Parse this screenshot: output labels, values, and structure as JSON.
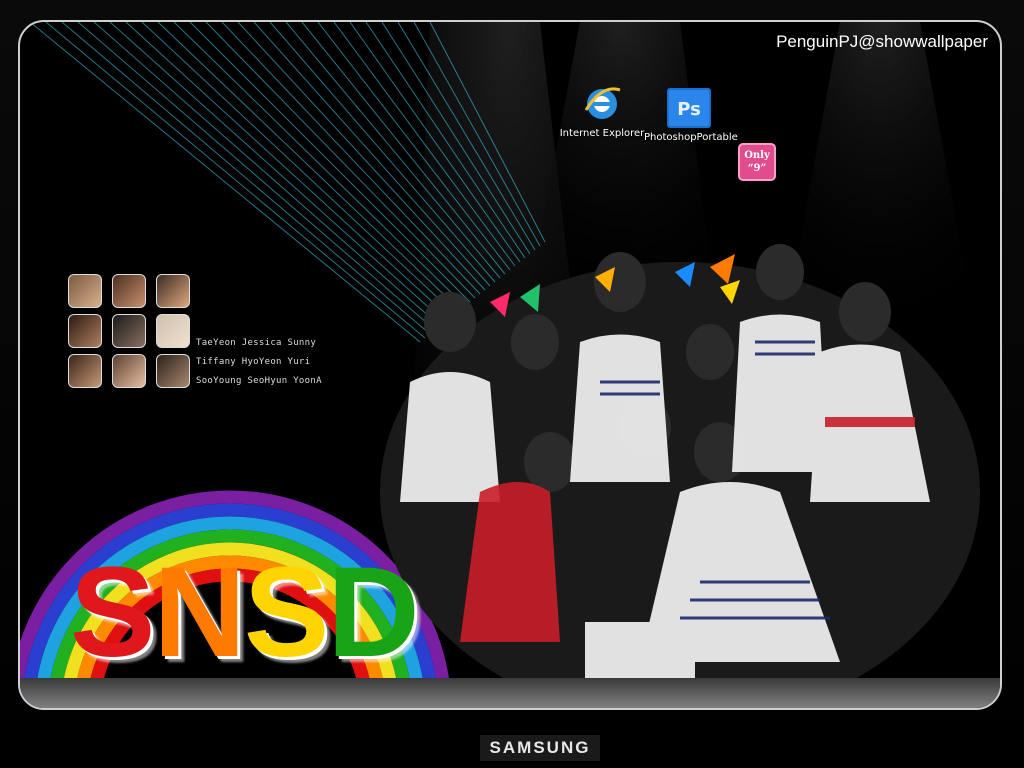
{
  "wallpaper": {
    "credit": "PenguinPJ@showwallpaper",
    "badge": {
      "line1": "Only",
      "line2": "“9”"
    },
    "members": [
      "TaeYeon Jessica Sunny",
      "Tiffany HyoYeon Yuri",
      "SooYoung SeoHyun YoonA"
    ],
    "logo": {
      "letters": [
        "S",
        "N",
        "S",
        "D"
      ],
      "colors": [
        "#e0181c",
        "#ff7a00",
        "#ffd400",
        "#19a316"
      ]
    }
  },
  "desktop": {
    "icons": [
      {
        "label": "Internet Explorer",
        "icon": "internet-explorer-icon"
      },
      {
        "label": "PhotoshopPortable",
        "icon": "photoshop-icon"
      }
    ]
  },
  "monitor": {
    "brand": "SAMSUNG"
  },
  "colors": {
    "rainbow": [
      "#7a1fa2",
      "#2a3fd0",
      "#1fa3e0",
      "#20b020",
      "#f0e020",
      "#ff8a00",
      "#e01010"
    ],
    "ps_blue": "#1b6fd0"
  }
}
